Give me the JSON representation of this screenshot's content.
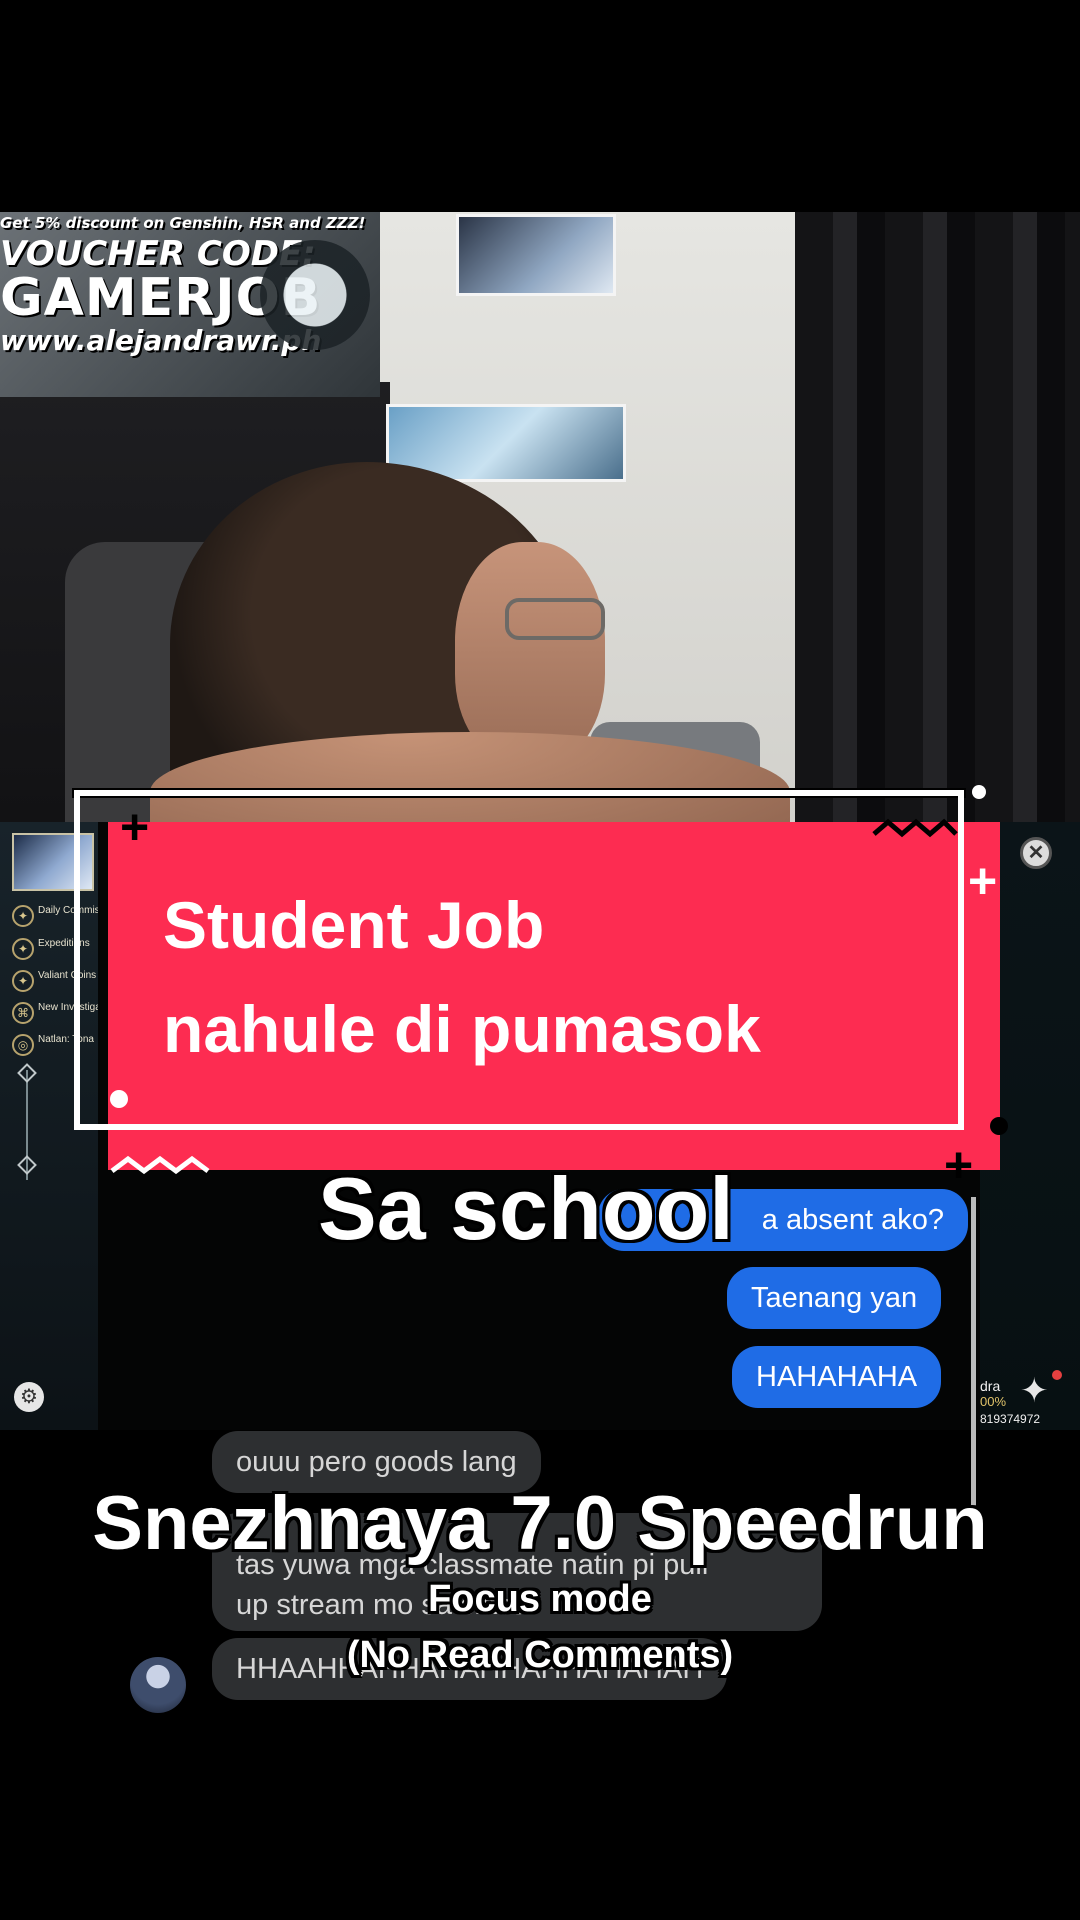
{
  "stream_banner": {
    "line1": "Get 5% discount on Genshin, HSR and ZZZ!",
    "line2": "VOUCHER CODE:",
    "line3": "GAMERJOB",
    "line4": "www.alejandrawr.ph"
  },
  "game_ui": {
    "tasks": [
      {
        "icon": "quest-icon",
        "text": "Daily Commission Rewards"
      },
      {
        "icon": "expedition-icon",
        "text": "Expeditions"
      },
      {
        "icon": "reward-icon",
        "text": "Valiant Coins Rewards"
      },
      {
        "icon": "domain-icon",
        "text": "New Investigation stage unlocked"
      },
      {
        "icon": "natlan-icon",
        "text": "Natlan: Tona"
      }
    ],
    "character_name": "dra",
    "character_percent": "00%",
    "uid": "819374972"
  },
  "chat": {
    "outgoing": [
      "a absent ako?",
      "Taenang yan",
      "HAHAHAHA"
    ],
    "incoming": [
      "ouuu pero goods lang",
      "tas yuwa mga classmate natin pi pull",
      "up stream mo sa class",
      "HHAAHHAHHAHAHHAHHAHAHAH"
    ]
  },
  "title_card": {
    "line1": "Student Job",
    "line2": "nahule di pumasok"
  },
  "captions": {
    "school": "Sa school",
    "main": "Snezhnaya 7.0 Speedrun",
    "focus": "Focus mode",
    "focus_sub": "(No Read Comments)"
  },
  "colors": {
    "card_red": "#fd2c51",
    "bubble_blue": "#1f6ce6",
    "bubble_gray": "#2d2f31"
  }
}
